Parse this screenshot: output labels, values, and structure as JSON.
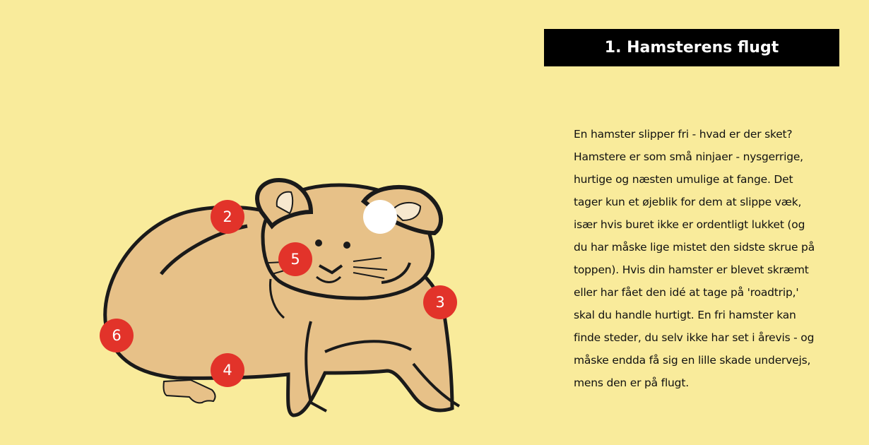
{
  "title": "1. Hamsterens flugt",
  "body": "En hamster slipper fri - hvad er der sket? Hamstere er som små ninjaer - nysgerrige, hurtige og næsten umulige at fange. Det tager kun et øjeblik for dem at slippe væk, især hvis buret ikke er ordentligt lukket (og du har måske lige mistet den sidste skrue på toppen). Hvis din hamster er blevet skræmt eller har fået den idé at tage på 'roadtrip,' skal du handle hurtigt. En fri hamster kan finde steder, du selv ikke har set i årevis - og måske endda få sig en lille skade undervejs, mens den er på flugt.",
  "hotspots": [
    {
      "label": "",
      "state": "active",
      "icon": "selected-dot"
    },
    {
      "label": "2",
      "state": "idle"
    },
    {
      "label": "3",
      "state": "idle"
    },
    {
      "label": "4",
      "state": "idle"
    },
    {
      "label": "5",
      "state": "idle"
    },
    {
      "label": "6",
      "state": "idle"
    }
  ],
  "colors": {
    "background": "#f9eb9b",
    "hotspot": "#e2332a",
    "hotspot_active": "#ffffff",
    "hamster_fur": "#e7c188",
    "outline": "#1a1a1a",
    "title_bg": "#000000"
  },
  "illustration": "hamster"
}
